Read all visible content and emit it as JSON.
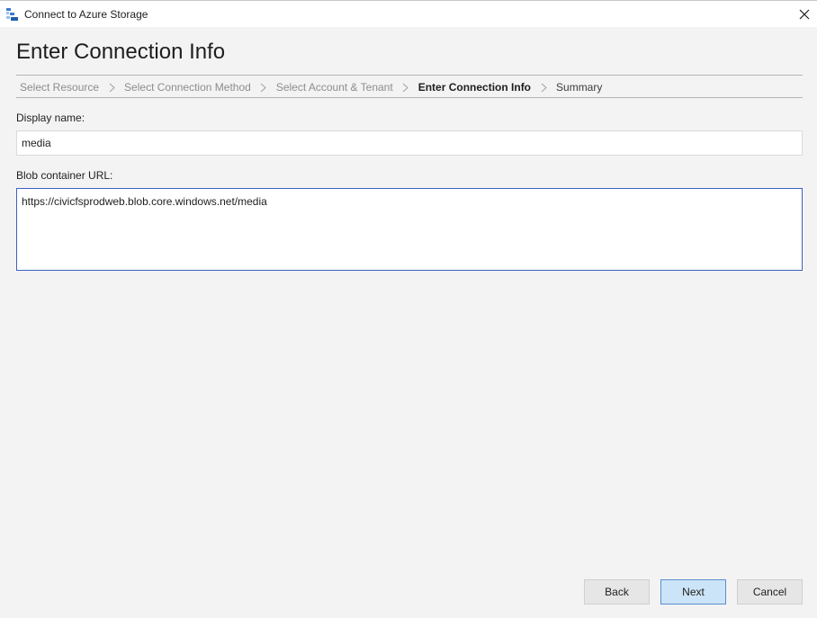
{
  "window": {
    "title": "Connect to Azure Storage",
    "icon": "azure-storage-explorer-icon",
    "close_icon": "close-icon"
  },
  "page": {
    "title": "Enter Connection Info"
  },
  "breadcrumb": {
    "separator_icon": "chevron-right-icon",
    "steps": [
      {
        "label": "Select Resource",
        "state": "completed"
      },
      {
        "label": "Select Connection Method",
        "state": "completed"
      },
      {
        "label": "Select Account & Tenant",
        "state": "completed"
      },
      {
        "label": "Enter Connection Info",
        "state": "current"
      },
      {
        "label": "Summary",
        "state": "upcoming"
      }
    ]
  },
  "form": {
    "display_name": {
      "label": "Display name:",
      "value": "media"
    },
    "blob_url": {
      "label": "Blob container URL:",
      "value": "https://civicfsprodweb.blob.core.windows.net/media"
    }
  },
  "buttons": {
    "back": "Back",
    "next": "Next",
    "cancel": "Cancel"
  },
  "colors": {
    "focus_border": "#3f5fc4",
    "primary_button_bg": "#cce4f7"
  }
}
